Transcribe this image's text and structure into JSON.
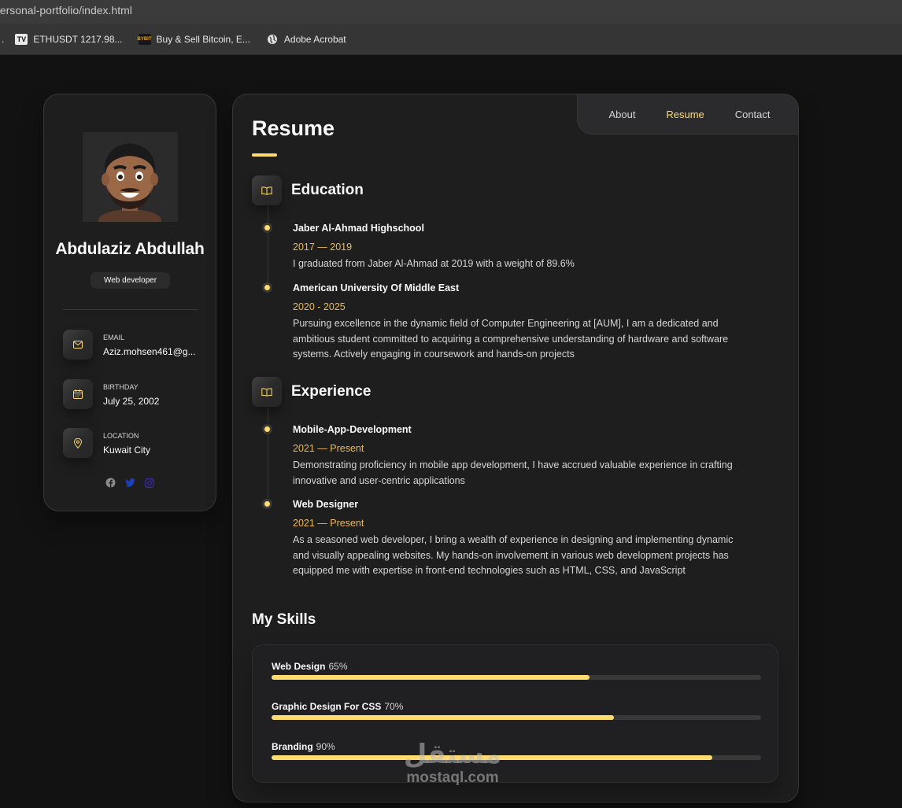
{
  "browser": {
    "url": "personal-portfolio/index.html",
    "bookmarks": [
      {
        "label": "ETHUSDT 1217.98...",
        "icon": "tradingview-icon"
      },
      {
        "label": "Buy & Sell Bitcoin, E...",
        "icon": "bybit-icon"
      },
      {
        "label": "Adobe Acrobat",
        "icon": "globe-icon"
      }
    ]
  },
  "sidebar": {
    "name": "Abdulaziz Abdullah",
    "title": "Web developer",
    "contacts": [
      {
        "label": "EMAIL",
        "value": "Aziz.mohsen461@g...",
        "icon": "mail-icon"
      },
      {
        "label": "BIRTHDAY",
        "value": "July 25, 2002",
        "icon": "calendar-icon"
      },
      {
        "label": "LOCATION",
        "value": "Kuwait City",
        "icon": "location-pin-icon"
      }
    ],
    "socials": [
      "facebook-icon",
      "twitter-icon",
      "instagram-icon"
    ]
  },
  "nav": {
    "items": [
      "About",
      "Resume",
      "Contact"
    ],
    "active": "Resume"
  },
  "main": {
    "title": "Resume",
    "education": {
      "title": "Education",
      "items": [
        {
          "title": "Jaber Al-Ahmad Highschool",
          "date": "2017 — 2019",
          "text": "I graduated from Jaber Al-Ahmad at 2019 with a weight of 89.6%"
        },
        {
          "title": "American University Of Middle East",
          "date": "2020 - 2025",
          "text": "Pursuing excellence in the dynamic field of Computer Engineering at [AUM], I am a dedicated and ambitious student committed to acquiring a comprehensive understanding of hardware and software systems. Actively engaging in coursework and hands-on projects"
        }
      ]
    },
    "experience": {
      "title": "Experience",
      "items": [
        {
          "title": "Mobile-App-Development",
          "date": "2021 — Present",
          "text": "Demonstrating proficiency in mobile app development, I have accrued valuable experience in crafting innovative and user-centric applications"
        },
        {
          "title": "Web Designer",
          "date": "2021 — Present",
          "text": "As a seasoned web developer, I bring a wealth of experience in designing and implementing dynamic and visually appealing websites. My hands-on involvement in various web development projects has equipped me with expertise in front-end technologies such as HTML, CSS, and JavaScript"
        }
      ]
    },
    "skills": {
      "title": "My Skills",
      "items": [
        {
          "name": "Web Design",
          "percent_label": "65%",
          "value": 65
        },
        {
          "name": "Graphic Design For CSS",
          "percent_label": "70%",
          "value": 70
        },
        {
          "name": "Branding",
          "percent_label": "90%",
          "value": 90
        }
      ]
    }
  },
  "watermark": {
    "arabic": "مستقل",
    "latin": "mostaql.com"
  },
  "colors": {
    "accent": "#ffdb70",
    "date": "#ebb954",
    "background": "#121212",
    "card": "#1e1e1f"
  }
}
